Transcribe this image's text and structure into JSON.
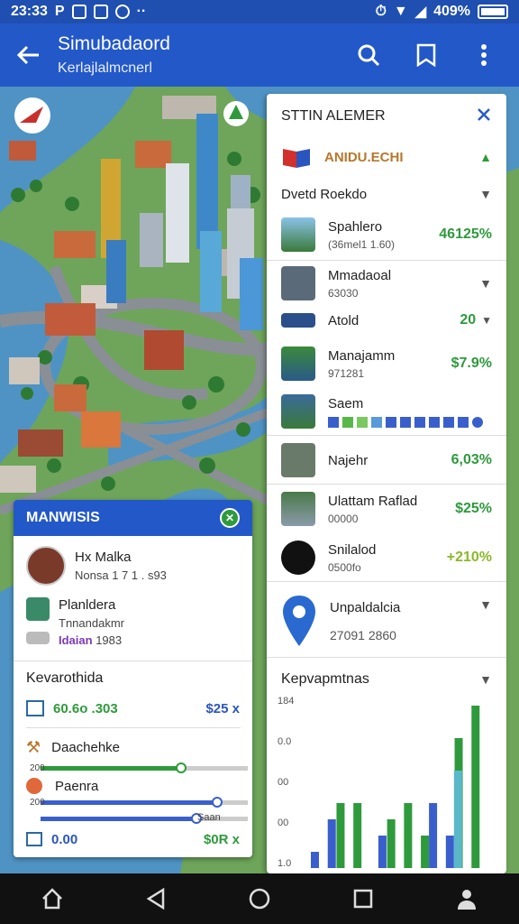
{
  "status_bar": {
    "time": "23:33",
    "letter": "P",
    "battery": "409%"
  },
  "app_bar": {
    "title": "Simubadaord",
    "subtitle": "Kerlajlalmcnerl"
  },
  "right_panel": {
    "title": "STTIN ALEMER",
    "section": "ANIDU.ECHI",
    "subsection": "Dvetd Roekdo",
    "items": [
      {
        "name": "Spahlero",
        "sub": "(36mel1 1.60)",
        "value": "46125%"
      },
      {
        "name": "Mmadaoal",
        "sub": "63030",
        "value": ""
      },
      {
        "name": "Atold",
        "sub": "",
        "value": "20"
      },
      {
        "name": "Manajamm",
        "sub": "971281",
        "value": "$7.9%"
      },
      {
        "name": "Saem",
        "sub": "",
        "value": ""
      },
      {
        "name": "Najehr",
        "sub": "",
        "value": "6,03%"
      },
      {
        "name": "Ulattam Raflad",
        "sub": "00000",
        "value": "$25%"
      },
      {
        "name": "Snilalod",
        "sub": "0500fo",
        "value": "+210%"
      },
      {
        "name": "Unpaldalcia",
        "sub": "27091 2860",
        "value": ""
      }
    ],
    "chart_title": "Kepvapmtnas"
  },
  "chart_data": {
    "type": "bar",
    "ytick_labels": [
      "1.0",
      "00",
      "00",
      "0.0",
      "184"
    ],
    "series": [
      {
        "color": "#2e9a3c",
        "values": [
          0,
          0,
          4,
          4,
          0,
          3,
          4,
          2,
          0,
          8,
          10
        ]
      },
      {
        "color": "#3a5fcc",
        "values": [
          1,
          3,
          0,
          0,
          2,
          0,
          0,
          4,
          2,
          0,
          0
        ]
      },
      {
        "color": "#5ab8c8",
        "values": [
          0,
          0,
          0,
          0,
          0,
          0,
          0,
          0,
          6,
          0,
          0
        ]
      }
    ]
  },
  "left_panel": {
    "title": "MANWISIS",
    "items": [
      {
        "name": "Hx Malka",
        "sub": "Nonsa 1 7 1 . s93"
      },
      {
        "name": "Planldera",
        "sub": "Tnnandakmr",
        "sub2": "Idaian",
        "sub2_value": "1983"
      }
    ],
    "section": "Kevarothida",
    "stat_left": "60.6o .303",
    "stat_right": "$25 x",
    "item3": "Daachehke",
    "item4": "Paenra",
    "sliders": [
      {
        "label": "200",
        "value": 0.68,
        "color": "#2e9a3c"
      },
      {
        "label": "200",
        "value": 0.85,
        "color": "#3a5fcc"
      },
      {
        "label": "",
        "value": 0.75,
        "color": "#3a5fcc"
      },
      {
        "label": "200",
        "value": 0.95,
        "color": "#3a5fcc"
      }
    ],
    "slider_label": "Saan",
    "stat2_left": "0.00",
    "stat2_right": "$0R x"
  }
}
